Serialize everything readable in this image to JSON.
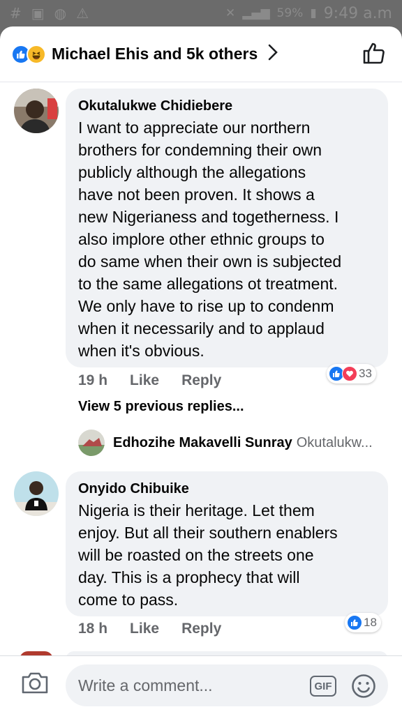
{
  "status_bar": {
    "battery": "59%",
    "time": "9:49 a.m"
  },
  "header": {
    "title": "Michael Ehis and 5k others"
  },
  "comments": [
    {
      "author": "Okutalukwe Chidiebere",
      "lines": [
        "I want to appreciate our northern",
        "brothers for condemning their own",
        "publicly although the allegations",
        "have not been proven. It shows a",
        "new  Nigerianess and togetherness. I",
        "also implore other ethnic groups to",
        "do same when their own is subjected",
        "to the same allegations ot treatment.",
        "We only have to  rise up to condenm",
        "when it necessarily and to applaud",
        "when it's obvious."
      ],
      "time": "19 h",
      "like": "Like",
      "reply": "Reply",
      "reaction_count": "33"
    },
    {
      "author": "Onyido Chibuike",
      "lines": [
        "Nigeria is their heritage. Let them",
        "enjoy. But all their southern enablers",
        "will be roasted on the streets one",
        "day. This is a prophecy that will",
        "come to pass."
      ],
      "time": "18 h",
      "like": "Like",
      "reply": "Reply",
      "reaction_count": "18"
    }
  ],
  "view_previous": "View 5 previous replies...",
  "reply_preview": {
    "author": "Edhozihe Makavelli Sunray",
    "snippet": "Okutalukw..."
  },
  "composer": {
    "placeholder": "Write a comment...",
    "gif_label": "GIF"
  },
  "colors": {
    "like_blue": "#1877f2",
    "love_red": "#f33e58",
    "bubble": "#f0f2f5",
    "meta_gray": "#65676b"
  }
}
